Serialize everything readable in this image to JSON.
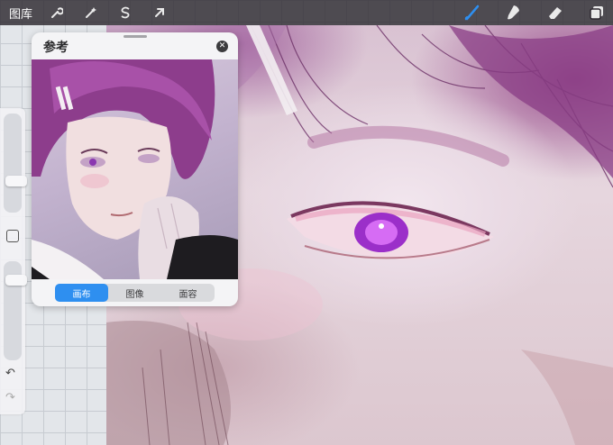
{
  "topbar": {
    "gallery_label": "图库",
    "left_tools": [
      {
        "name": "adjustments-wrench-icon",
        "glyph": "🔧"
      },
      {
        "name": "magic-wand-icon",
        "glyph": "✦"
      },
      {
        "name": "selection-s-icon",
        "glyph": "S"
      },
      {
        "name": "transform-arrow-icon",
        "glyph": "➚"
      }
    ],
    "right_tools": [
      {
        "name": "brush-icon",
        "active": true
      },
      {
        "name": "smudge-icon"
      },
      {
        "name": "eraser-icon"
      },
      {
        "name": "layers-icon"
      }
    ],
    "accent_color": "#2e8ff0"
  },
  "reference_panel": {
    "title": "参考",
    "close_glyph": "✕",
    "tabs": [
      "画布",
      "图像",
      "面容"
    ],
    "selected_tab": "画布"
  },
  "sidebar": {
    "brush_size_level": 0.3,
    "opacity_level": 0.85,
    "undo_glyph": "↶",
    "redo_glyph": "↷"
  }
}
